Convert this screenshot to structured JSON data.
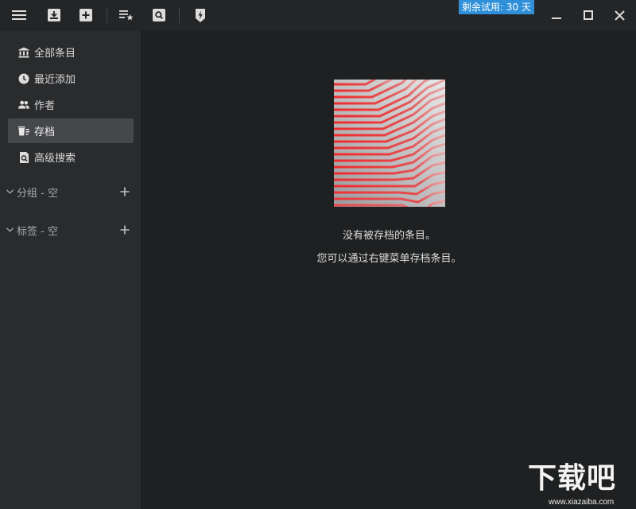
{
  "titlebar": {
    "trial_badge": "剩余试用: 30 天",
    "icons": [
      "menu-icon",
      "import-icon",
      "add-icon",
      "reading-list-icon",
      "search-icon",
      "lightning-icon"
    ],
    "window_controls": [
      "minimize-icon",
      "maximize-icon",
      "close-icon"
    ]
  },
  "sidebar": {
    "items": [
      {
        "label": "全部条目",
        "icon": "library-icon",
        "active": false
      },
      {
        "label": "最近添加",
        "icon": "clock-icon",
        "active": false
      },
      {
        "label": "作者",
        "icon": "people-icon",
        "active": false
      },
      {
        "label": "存档",
        "icon": "archive-icon",
        "active": true
      },
      {
        "label": "高级搜索",
        "icon": "advanced-search-icon",
        "active": false
      }
    ],
    "sections": [
      {
        "label": "分组 - 空"
      },
      {
        "label": "标签 - 空"
      }
    ]
  },
  "main": {
    "empty_line1": "没有被存档的条目。",
    "empty_line2": "您可以通过右键菜单存档条目。"
  },
  "watermark": {
    "big": "下载吧",
    "small": "www.xiazaiba.com"
  },
  "colors": {
    "titlebar_bg": "#242526",
    "sidebar_bg": "#2a2b2d",
    "main_bg": "#1f2021",
    "active_item_bg": "#45474a",
    "badge_bg": "#2f8fd8",
    "art_red": "#e83a3a"
  }
}
